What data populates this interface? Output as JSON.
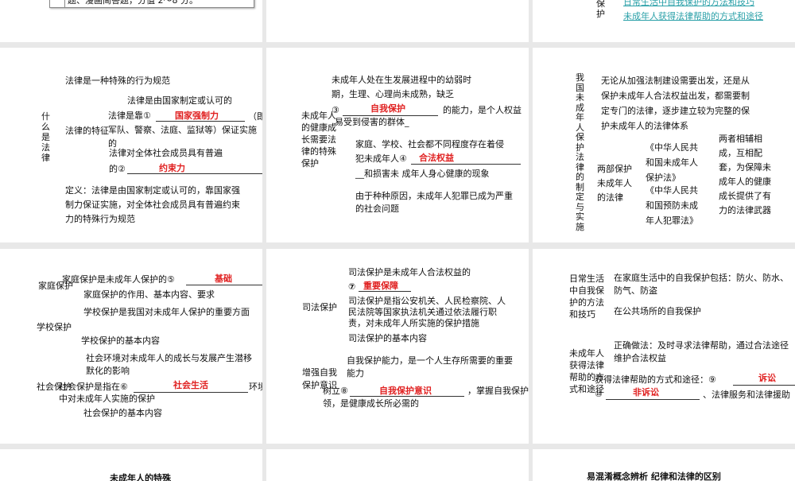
{
  "row0": {
    "s1": {
      "box_text": "题、漫画简答题，分值 2～8 分。"
    },
    "s3": {
      "side_label": "保护",
      "links": [
        "日常生活中自我保护的方法和技巧",
        "未成年人获得法律帮助的方式和途径"
      ]
    }
  },
  "row1": {
    "s1": {
      "title": "什么是法律",
      "l1": "法律是一种特殊的行为规范",
      "l2": "法律是由国家制定或认可的",
      "feature": "法律的特征",
      "l3a": "法律是靠①",
      "l3b": "（即军队、警察、法庭、监狱等）保证实施的",
      "ans1": "国家强制力",
      "l4": "法律对全体社会成员具有普遍",
      "l5": "的②",
      "ans2": "约束力",
      "def": "定义：法律是由国家制定或认可的，靠国家强制力保证实施，对全体社会成员具有普遍约束力的特殊行为规范"
    },
    "s2": {
      "side": "未成年人的健康成长需要法律的特殊保护",
      "l1": "未成年人处在生发展进程中的幼弱时",
      "l2": "期，生理、心理尚未成熟，缺乏",
      "l3a": "③",
      "ans3": "自我保护",
      "l3b": "的能力，是个人权益",
      "l4": "易受到侵害的群体_",
      "l5": "家庭、学校、社会都不同程度存在着侵",
      "l6": "犯未成年人④",
      "ans4": "合法权益",
      "l7": "__和损害未 成年人身心健康的现象",
      "l8": "由于种种原因，未成年人犯罪已成为严重的社会问题"
    },
    "s3": {
      "side": "我国未成年人保护法律的制定与实施",
      "intro": "无论从加强法制建设需要出发，还是从保护未成年人合法权益出发，都需要制定专门的法律，逐步建立较为完整的保护未成年人的法律体系",
      "two_laws": "两部保护未成年人的法律",
      "law1": "《中华人民共和国未成年人保护法》",
      "law2": "《中华人民共和国预防未成年人犯罪法》",
      "effect": "两者相辅相成，互相配套，为保障未成年人的健康成长提供了有力的法律武器"
    }
  },
  "row2": {
    "s1": {
      "family": "家庭保护",
      "f1": "家庭保护是未成年人保护的⑤",
      "ans5": "基础",
      "f2": "家庭保护的作用、基本内容、要求",
      "school": "学校保护",
      "sc1": "学校保护是我国对未成年人保护的重要方面",
      "sc2": "学校保护的基本内容",
      "society": "社会保护",
      "so1": "社会环境对未成年人的成长与发展产生潜移默化的影响",
      "so2a": "社会保护是指在⑥",
      "ans6": "社会生活",
      "so2b": "环境",
      "so3": "中对未成年人实施的保护",
      "so4": "社会保护的基本内容"
    },
    "s2": {
      "judicial": "司法保护",
      "j1": "司法保护是未成年人合法权益的",
      "j2": "⑦",
      "ans7": "重要保障",
      "j3": "司法保护是指公安机关、人民检察院、人民法院等国家执法机关通过依法履行职责，对未成年人所实施的保护措施",
      "j4": "司法保护的基本内容",
      "self": "增强自我保护意识",
      "s1": "自我保护能力，是一个人生存所需要的重要能力",
      "s2a": "树立⑧",
      "ans8": "自我保护意识",
      "s2b": "，掌握自我保护本",
      "s3": "领，是健康成长所必需的"
    },
    "s3": {
      "daily": "日常生活中自我保护的方法和技巧",
      "d1": "在家庭生活中的自我保护包括：防火、防水、防气、防盗",
      "d2": "在公共场所的自我保护",
      "help": "未成年人获得法律帮助的方式和途径",
      "h1": "正确做法：及时寻求法律帮助，通过合法途径维护合法权益",
      "h2": "获得法律帮助的方式和途径：⑨",
      "ans9": "诉讼",
      "h3a": "⑩",
      "ans10": "非诉讼",
      "h3b": "、法律服务和法律援助"
    }
  },
  "row3": {
    "s1": {
      "text": "未成年人的特殊"
    },
    "s3": {
      "text": "易混淆概念辨析 纪律和法律的区别"
    }
  },
  "colors": {
    "gutter": "#e8e8e8",
    "answer": "#e02020",
    "link": "#2aa0a8"
  }
}
